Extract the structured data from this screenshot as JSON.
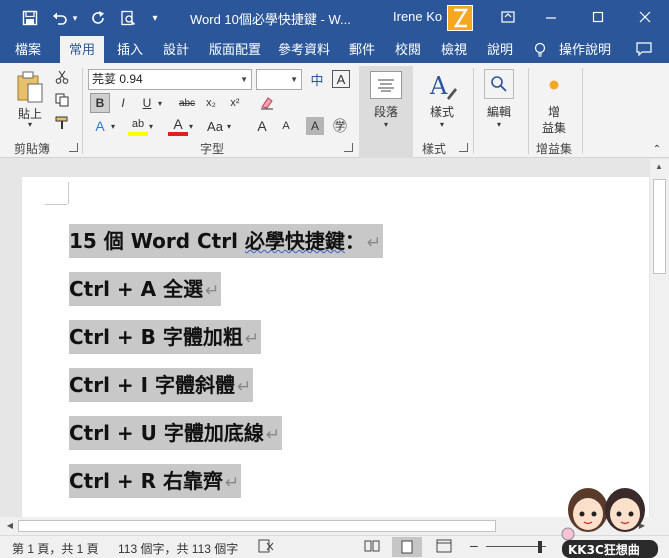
{
  "window": {
    "title": "Word 10個必學快捷鍵 - W...",
    "user": "Irene Ko"
  },
  "quick_access": [
    {
      "icon": "save-icon",
      "glyph": "▣"
    },
    {
      "icon": "undo-icon",
      "glyph": "↶"
    },
    {
      "icon": "undo-dropdown-icon",
      "glyph": "▾"
    },
    {
      "icon": "redo-icon",
      "glyph": "↻"
    },
    {
      "icon": "print-preview-icon",
      "glyph": "⎙"
    },
    {
      "icon": "customize-icon",
      "glyph": "▾"
    }
  ],
  "tabs": [
    "檔案",
    "常用",
    "插入",
    "設計",
    "版面配置",
    "參考資料",
    "郵件",
    "校閱",
    "檢視",
    "說明",
    "操作說明"
  ],
  "ribbon": {
    "paste_label": "貼上",
    "clipboard_group": "剪貼簿",
    "font_name": "芫荽 0.94",
    "font_size": "",
    "font_group": "字型",
    "paragraph_label": "段落",
    "styles_label": "樣式",
    "styles_group": "樣式",
    "editing_label": "編輯",
    "addins_label_1": "增",
    "addins_label_2": "益集",
    "addins_group": "增益集",
    "format_buttons": [
      "B",
      "I",
      "U",
      "abc",
      "x₂",
      "x²"
    ],
    "font_buttons_row3": [
      "A",
      "ab",
      "A",
      "Aa",
      "A",
      "A",
      "A",
      "㊫"
    ],
    "phonetic": "中",
    "char_border": "A"
  },
  "document": {
    "lines": [
      {
        "pre": "15 個 Word Ctrl  ",
        "squiggle": "必學快捷鍵",
        "post": "：",
        "mark": "↵"
      },
      {
        "text": "Ctrl + A  全選",
        "mark": "↵"
      },
      {
        "text": "Ctrl + B  字體加粗",
        "mark": "↵"
      },
      {
        "text": "Ctrl + I  字體斜體",
        "mark": "↵"
      },
      {
        "text": "Ctrl + U  字體加底線",
        "mark": "↵"
      },
      {
        "text": "Ctrl + R  右靠齊",
        "mark": "↵"
      }
    ]
  },
  "status": {
    "page": "第 1 頁，共 1 頁",
    "words": "113 個字，共 113 個字"
  },
  "mascot_text": "KK3C狂想曲"
}
